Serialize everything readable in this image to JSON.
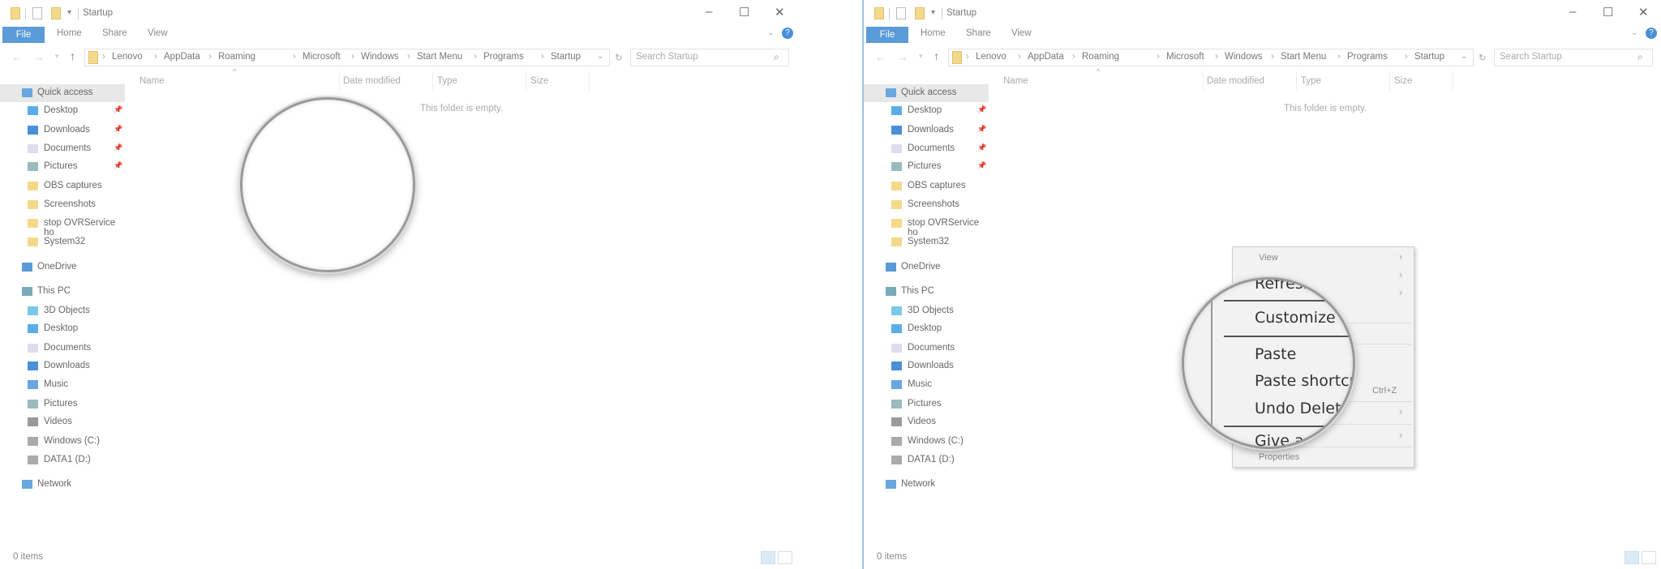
{
  "window": {
    "title": "Startup",
    "controls": {
      "minimize": "–",
      "maximize": "☐",
      "close": "✕"
    },
    "ribbon_tabs": [
      "File",
      "Home",
      "Share",
      "View"
    ],
    "breadcrumb": [
      "Lenovo",
      "AppData",
      "Roaming",
      "Microsoft",
      "Windows",
      "Start Menu",
      "Programs",
      "Startup"
    ],
    "search_placeholder": "Search Startup",
    "columns": [
      "Name",
      "Date modified",
      "Type",
      "Size"
    ],
    "empty_message": "This folder is empty.",
    "status": "0 items",
    "sidebar": [
      {
        "label": "Quick access",
        "icon": "star-icon",
        "level": 0,
        "pinned": false
      },
      {
        "label": "Desktop",
        "icon": "desktop-icon",
        "level": 1,
        "pinned": true
      },
      {
        "label": "Downloads",
        "icon": "download-icon",
        "level": 1,
        "pinned": true
      },
      {
        "label": "Documents",
        "icon": "document-icon",
        "level": 1,
        "pinned": true
      },
      {
        "label": "Pictures",
        "icon": "pictures-icon",
        "level": 1,
        "pinned": true
      },
      {
        "label": "OBS captures",
        "icon": "folder-icon",
        "level": 1,
        "pinned": false
      },
      {
        "label": "Screenshots",
        "icon": "folder-icon",
        "level": 1,
        "pinned": false
      },
      {
        "label": "stop OVRService ho",
        "icon": "folder-icon",
        "level": 1,
        "pinned": false
      },
      {
        "label": "System32",
        "icon": "folder-icon",
        "level": 1,
        "pinned": false
      },
      {
        "label": "OneDrive",
        "icon": "cloud-icon",
        "level": 0,
        "pinned": false
      },
      {
        "label": "This PC",
        "icon": "computer-icon",
        "level": 0,
        "pinned": false
      },
      {
        "label": "3D Objects",
        "icon": "cube-icon",
        "level": 1,
        "pinned": false
      },
      {
        "label": "Desktop",
        "icon": "desktop-icon",
        "level": 1,
        "pinned": false
      },
      {
        "label": "Documents",
        "icon": "document-icon",
        "level": 1,
        "pinned": false
      },
      {
        "label": "Downloads",
        "icon": "download-icon",
        "level": 1,
        "pinned": false
      },
      {
        "label": "Music",
        "icon": "music-icon",
        "level": 1,
        "pinned": false
      },
      {
        "label": "Pictures",
        "icon": "pictures-icon",
        "level": 1,
        "pinned": false
      },
      {
        "label": "Videos",
        "icon": "video-icon",
        "level": 1,
        "pinned": false
      },
      {
        "label": "Windows (C:)",
        "icon": "drive-icon",
        "level": 1,
        "pinned": false
      },
      {
        "label": "DATA1 (D:)",
        "icon": "drive-icon",
        "level": 1,
        "pinned": false
      },
      {
        "label": "Network",
        "icon": "network-icon",
        "level": 0,
        "pinned": false
      }
    ]
  },
  "context_menu": {
    "view": "View",
    "ctrl_z": "Ctrl+Z",
    "properties": "Properties",
    "magnified": {
      "refresh": "Refresh",
      "customize": "Customize this folder...",
      "paste": "Paste",
      "paste_shortcut": "Paste shortcut",
      "undo_delete": "Undo Delete",
      "give_access": "Give access to"
    }
  },
  "colors": {
    "accent": "#5a9bd8",
    "help": "#4a8fd8"
  }
}
